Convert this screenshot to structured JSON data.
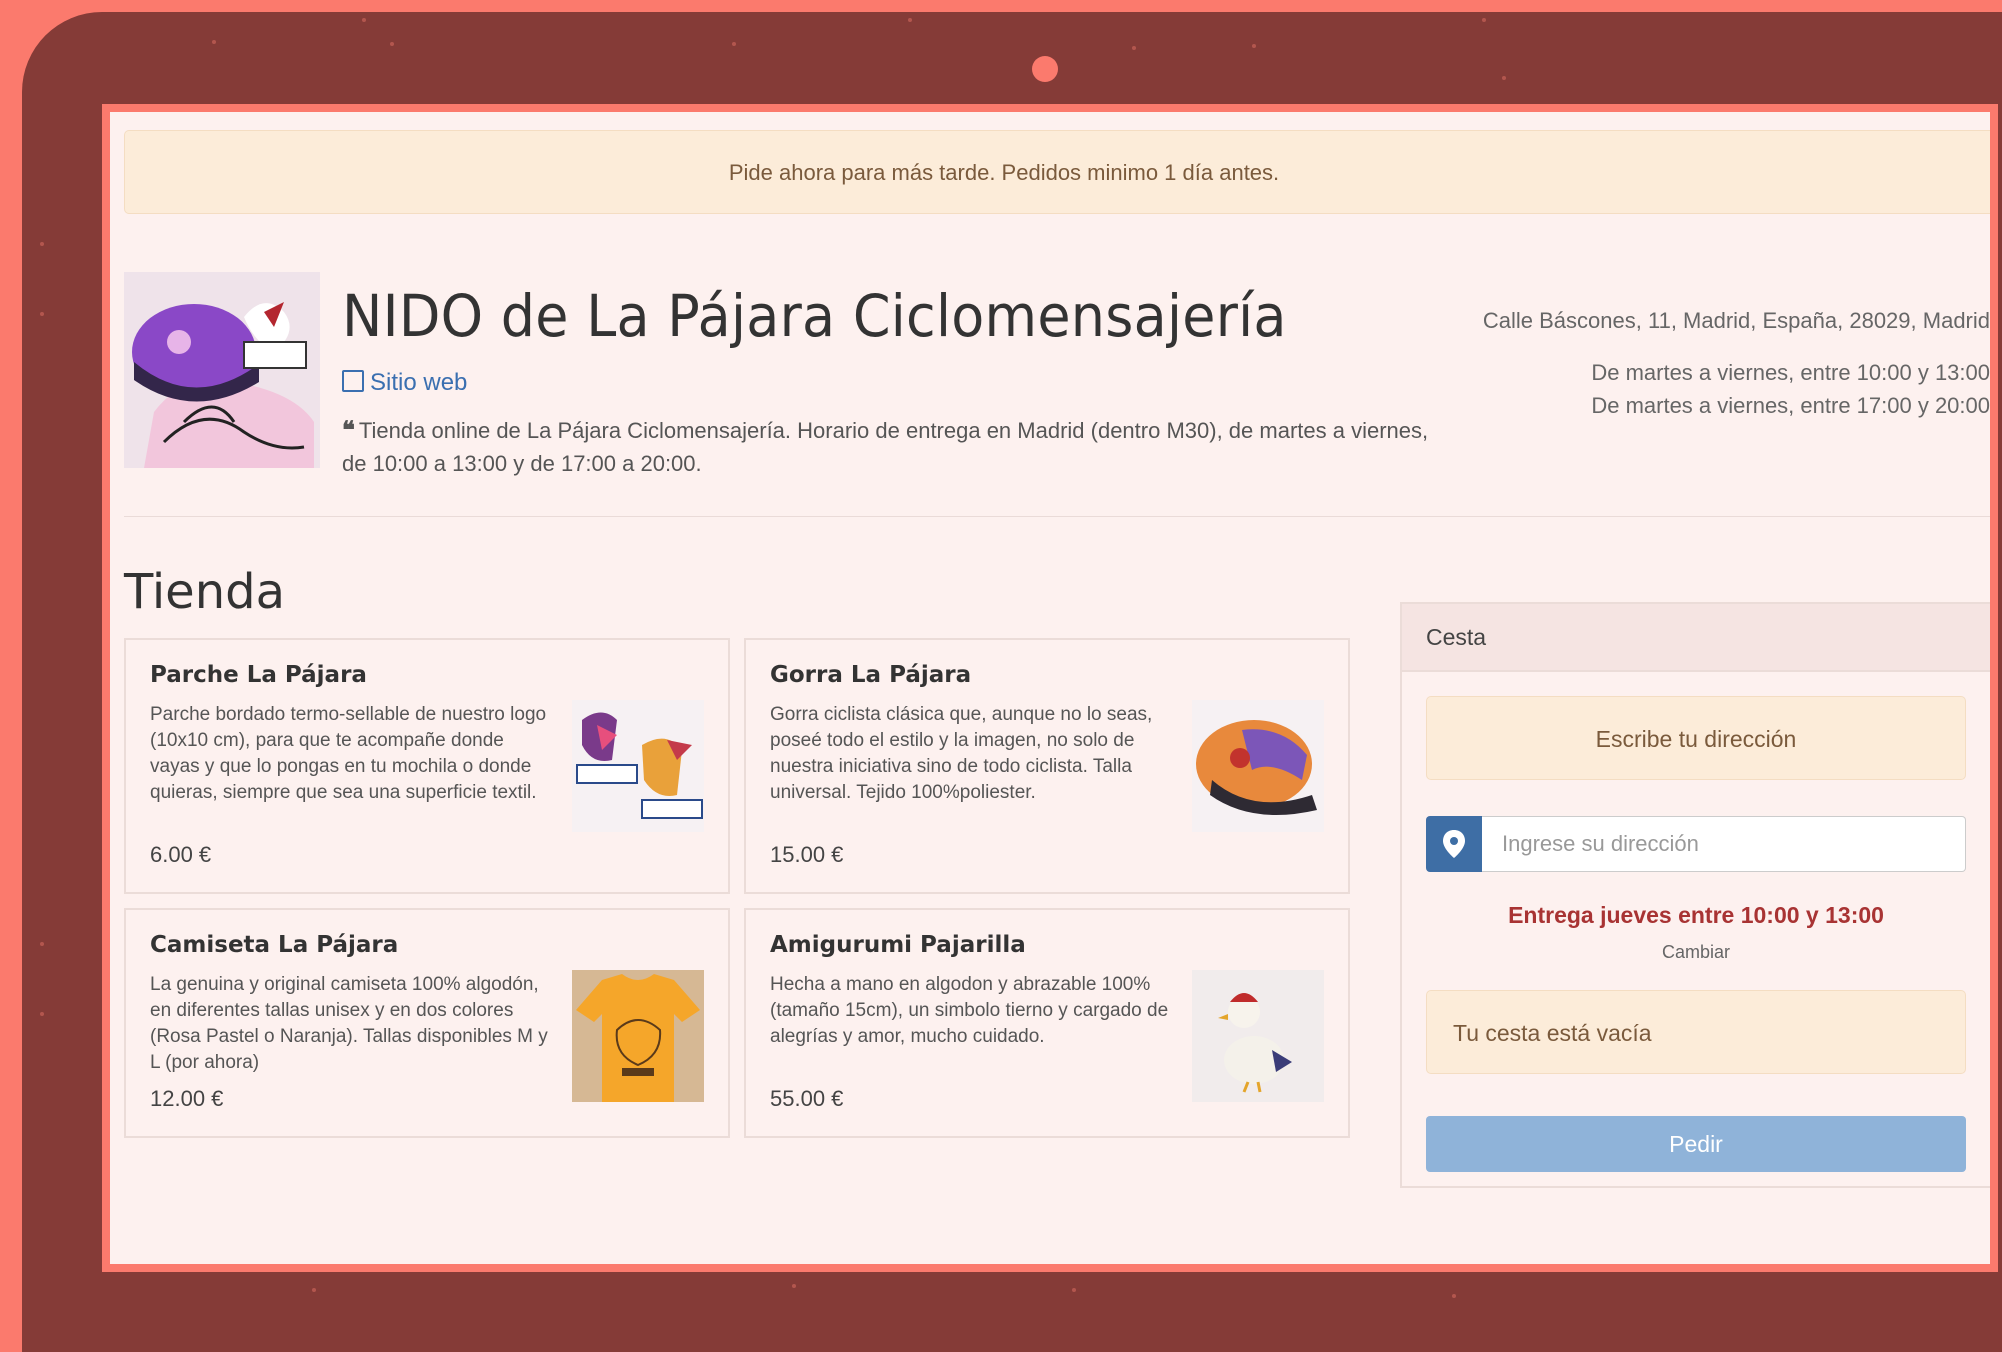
{
  "notice": "Pide ahora para más tarde. Pedidos minimo 1 día antes.",
  "store": {
    "title": "NIDO de La Pájara Ciclomensajería",
    "website_label": "Sitio web",
    "description": "Tienda online de La Pájara Ciclomensajería. Horario de entrega en Madrid (dentro M30), de martes a viernes, de 10:00 a 13:00 y de 17:00 a 20:00.",
    "address": "Calle Báscones, 11, Madrid, España, 28029, Madrid",
    "hours": [
      "De martes a viernes, entre 10:00 y 13:00",
      "De martes a viernes, entre 17:00 y 20:00"
    ]
  },
  "shop": {
    "title": "Tienda",
    "products": [
      {
        "name": "Parche La Pájara",
        "description": "Parche bordado termo-sellable de nuestro logo (10x10 cm), para que te acompañe donde vayas y que lo pongas en tu mochila o donde quieras, siempre que sea una superficie textil.",
        "price": "6.00 €"
      },
      {
        "name": "Gorra La Pájara",
        "description": "Gorra ciclista clásica que, aunque no lo seas, poseé todo el estilo y la imagen, no solo de nuestra iniciativa sino de todo ciclista. Talla universal. Tejido 100%poliester.",
        "price": "15.00 €"
      },
      {
        "name": "Camiseta La Pájara",
        "description": "La genuina y original camiseta 100% algodón, en diferentes tallas unisex y en dos colores (Rosa Pastel o Naranja). Tallas disponibles M y L (por ahora)",
        "price": "12.00 €"
      },
      {
        "name": "Amigurumi Pajarilla",
        "description": "Hecha a mano en algodon y abrazable 100% (tamaño 15cm), un simbolo tierno y cargado de alegrías y amor, mucho cuidado.",
        "price": "55.00 €"
      }
    ]
  },
  "basket": {
    "title": "Cesta",
    "address_prompt": "Escribe tu dirección",
    "address_placeholder": "Ingrese su dirección",
    "delivery_text": "Entrega jueves entre 10:00 y 13:00",
    "change_label": "Cambiar",
    "empty_text": "Tu cesta está vacía",
    "order_label": "Pedir"
  },
  "colors": {
    "frame_outer": "#fb7a6d",
    "frame_device": "#853b37",
    "page_background": "#fdf1ef",
    "warning_background": "#fcecd9",
    "link": "#3a6fb0",
    "delivery_text": "#a83333",
    "order_button": "#8fb3d9"
  }
}
